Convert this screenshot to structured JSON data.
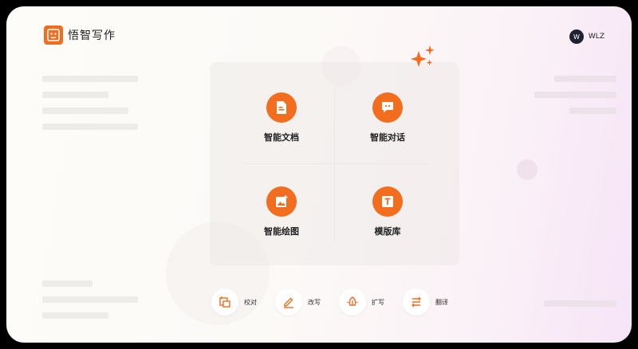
{
  "header": {
    "app_name": "悟智写作",
    "logo_icon": "logo-face-icon"
  },
  "user": {
    "avatar_initial": "W",
    "name": "WLZ"
  },
  "features": [
    {
      "label": "智能文档",
      "icon": "document-icon"
    },
    {
      "label": "智能对话",
      "icon": "chat-icon"
    },
    {
      "label": "智能绘图",
      "icon": "image-icon"
    },
    {
      "label": "模版库",
      "icon": "template-icon"
    }
  ],
  "tools": [
    {
      "label": "校对",
      "icon": "proofread-icon"
    },
    {
      "label": "改写",
      "icon": "rewrite-icon"
    },
    {
      "label": "扩写",
      "icon": "expand-icon"
    },
    {
      "label": "翻译",
      "icon": "translate-icon"
    }
  ],
  "colors": {
    "accent": "#f26d1e",
    "avatar_bg": "#1f2331"
  }
}
